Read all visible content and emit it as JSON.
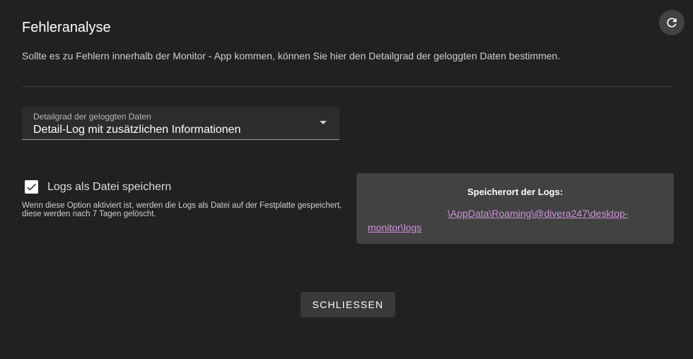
{
  "dialog": {
    "title": "Fehleranalyse",
    "description": "Sollte es zu Fehlern innerhalb der Monitor - App kommen, können Sie hier den Detailgrad der geloggten Daten bestimmen.",
    "refresh_icon": "refresh-icon"
  },
  "log_level_select": {
    "label": "Detailgrad der geloggten Daten",
    "value": "Detail-Log mit zusätzlichen Informationen",
    "arrow_icon": "dropdown-arrow-icon"
  },
  "save_logs": {
    "checked": true,
    "label": "Logs als Datei speichern",
    "hint": "Wenn diese Option aktiviert ist, werden die Logs als Datei auf der Festplatte gespeichert, diese werden nach 7 Tagen gelöscht."
  },
  "storage": {
    "title": "Speicherort der Logs:",
    "path": "\\AppData\\Roaming\\@divera247\\desktop-monitor\\logs",
    "link_color": "#ce93d8"
  },
  "actions": {
    "close_label": "SCHLIESSEN"
  },
  "colors": {
    "background": "#212121",
    "surface": "#424242",
    "field": "#2c2c2c"
  }
}
